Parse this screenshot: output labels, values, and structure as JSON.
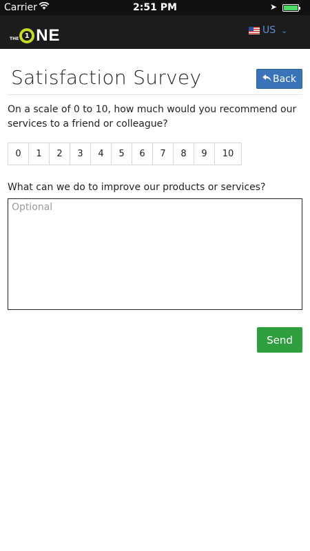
{
  "status_bar": {
    "carrier": "Carrier",
    "time": "2:51 PM",
    "battery_level": 1.0
  },
  "header": {
    "logo_small": "THE",
    "logo_main": "NE",
    "language_code": "US"
  },
  "page": {
    "title": "Satisfaction Survey",
    "back_label": "Back"
  },
  "survey": {
    "question_recommend": "On a scale of 0 to 10, how much would you recommend our services to a friend or colleague?",
    "scale": [
      "0",
      "1",
      "2",
      "3",
      "4",
      "5",
      "6",
      "7",
      "8",
      "9",
      "10"
    ],
    "question_improve": "What can we do to improve our products or services?",
    "feedback_placeholder": "Optional",
    "feedback_value": "",
    "send_label": "Send"
  },
  "colors": {
    "back_button": "#3a73b7",
    "send_button": "#2f9e3f",
    "logo_accent": "#c6d82e",
    "header_bg": "#1c1c1c"
  }
}
